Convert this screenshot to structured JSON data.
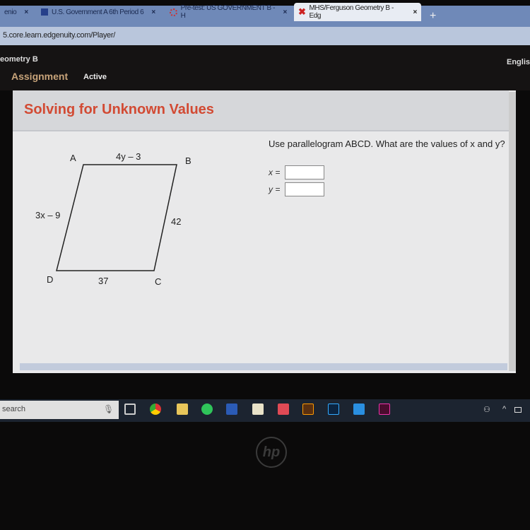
{
  "browser": {
    "tabs": [
      {
        "label": "enio"
      },
      {
        "label": "U.S. Government A 6th Period 6"
      },
      {
        "label": "Pre-test: US GOVERNMENT B - H"
      },
      {
        "label": "MHS/Ferguson Geometry B - Edg",
        "active": true
      }
    ],
    "new_tab": "+",
    "close": "×",
    "url": "5.core.learn.edgenuity.com/Player/"
  },
  "header": {
    "course": "eometry B",
    "language": "Englis",
    "assignment": "Assignment",
    "status": "Active"
  },
  "lesson": {
    "title": "Solving for Unknown Values",
    "question": "Use parallelogram ABCD. What are the values of x and y?",
    "x_label": "x =",
    "y_label": "y =",
    "x_value": "",
    "y_value": ""
  },
  "figure": {
    "A": "A",
    "B": "B",
    "C": "C",
    "D": "D",
    "top": "4y – 3",
    "left": "3x – 9",
    "right": "42",
    "bottom": "37"
  },
  "taskbar": {
    "search": "search",
    "apps": [
      "cortana-mic",
      "task-view",
      "chrome",
      "file-explorer",
      "spotify",
      "word",
      "store",
      "app-red",
      "illustrator",
      "photoshop",
      "mail",
      "indesign"
    ]
  },
  "colors": {
    "title": "#d24a33",
    "assignment": "#c8a47a"
  },
  "logo": "hp"
}
